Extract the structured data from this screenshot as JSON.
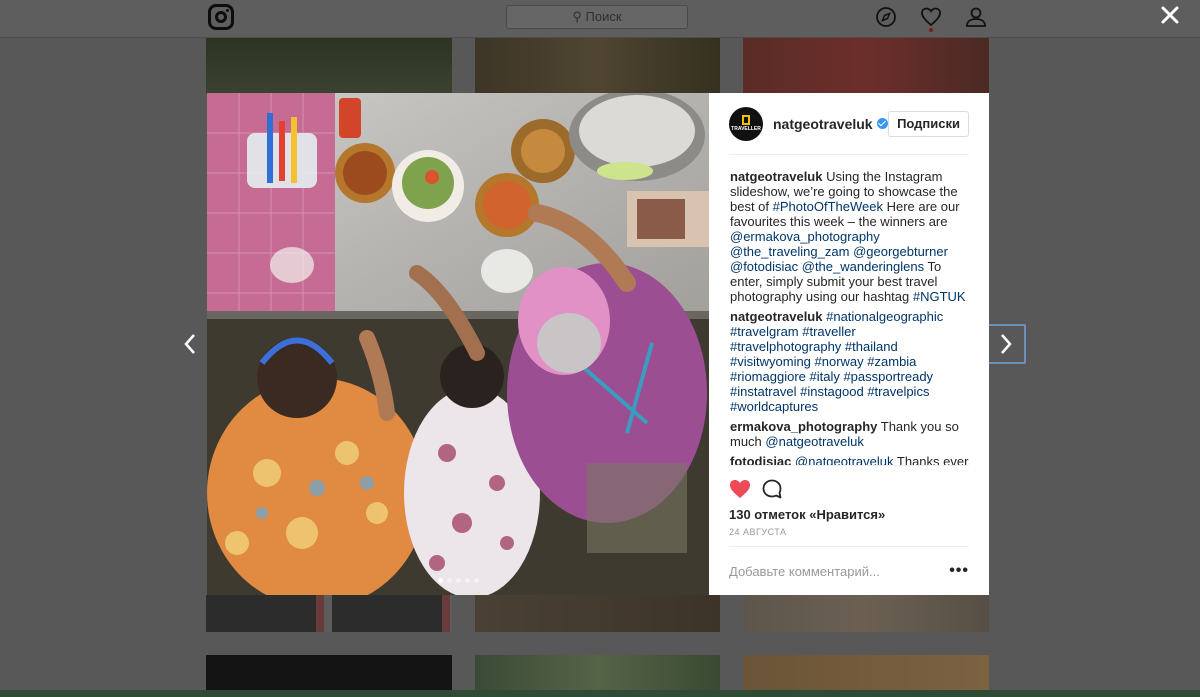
{
  "topbar": {
    "search_placeholder": "Поиск",
    "icons": [
      "instagram-logo-icon",
      "compass-icon",
      "heart-icon",
      "user-icon"
    ]
  },
  "modal": {
    "account": {
      "username": "natgeotraveluk",
      "avatar_lines": [
        "NATIONAL",
        "GEOGRAPHIC",
        "TRAVELLER"
      ],
      "follow_label": "Подписки"
    },
    "caption": {
      "user": "natgeotraveluk",
      "t1": " Using the Instagram slideshow, we’re going to showcase the best of ",
      "tag1": "#PhotoOfTheWeek",
      "t2": " Here are our favourites this week – the winners are ",
      "m1": "@ermakova_photography",
      "m2": "@the_traveling_zam",
      "m3": "@georgebturner",
      "m4": "@fotodisiac",
      "m5": "@the_wanderinglens",
      "t3": " To enter, simply submit your best travel photography using our hashtag ",
      "tag2": "#NGTUK"
    },
    "hashtag_comment": {
      "user": "natgeotraveluk",
      "tags": "#nationalgeographic #travelgram #traveller #travelphotography #thailand #visitwyoming #norway #zambia #riomaggiore #italy #passportready #instatravel #instagood #travelpics #worldcaptures"
    },
    "comment2": {
      "user": "ermakova_photography",
      "text": " Thank you so much ",
      "mention": "@natgeotraveluk"
    },
    "comment3": {
      "user": "fotodisiac",
      "mention": "@natgeotraveluk",
      "text": " Thanks ever so much for the feature and also for your great work 😊❤️😊"
    },
    "likes_label": "130 отметок «Нравится»",
    "date": "24 АВГУСТА",
    "comment_placeholder": "Добавьте комментарий...",
    "more_label": "•••",
    "slides": {
      "count": 5,
      "active": 1
    }
  },
  "colors": {
    "like_red": "#ed4956",
    "link": "#003569",
    "verified": "#3897f0"
  }
}
